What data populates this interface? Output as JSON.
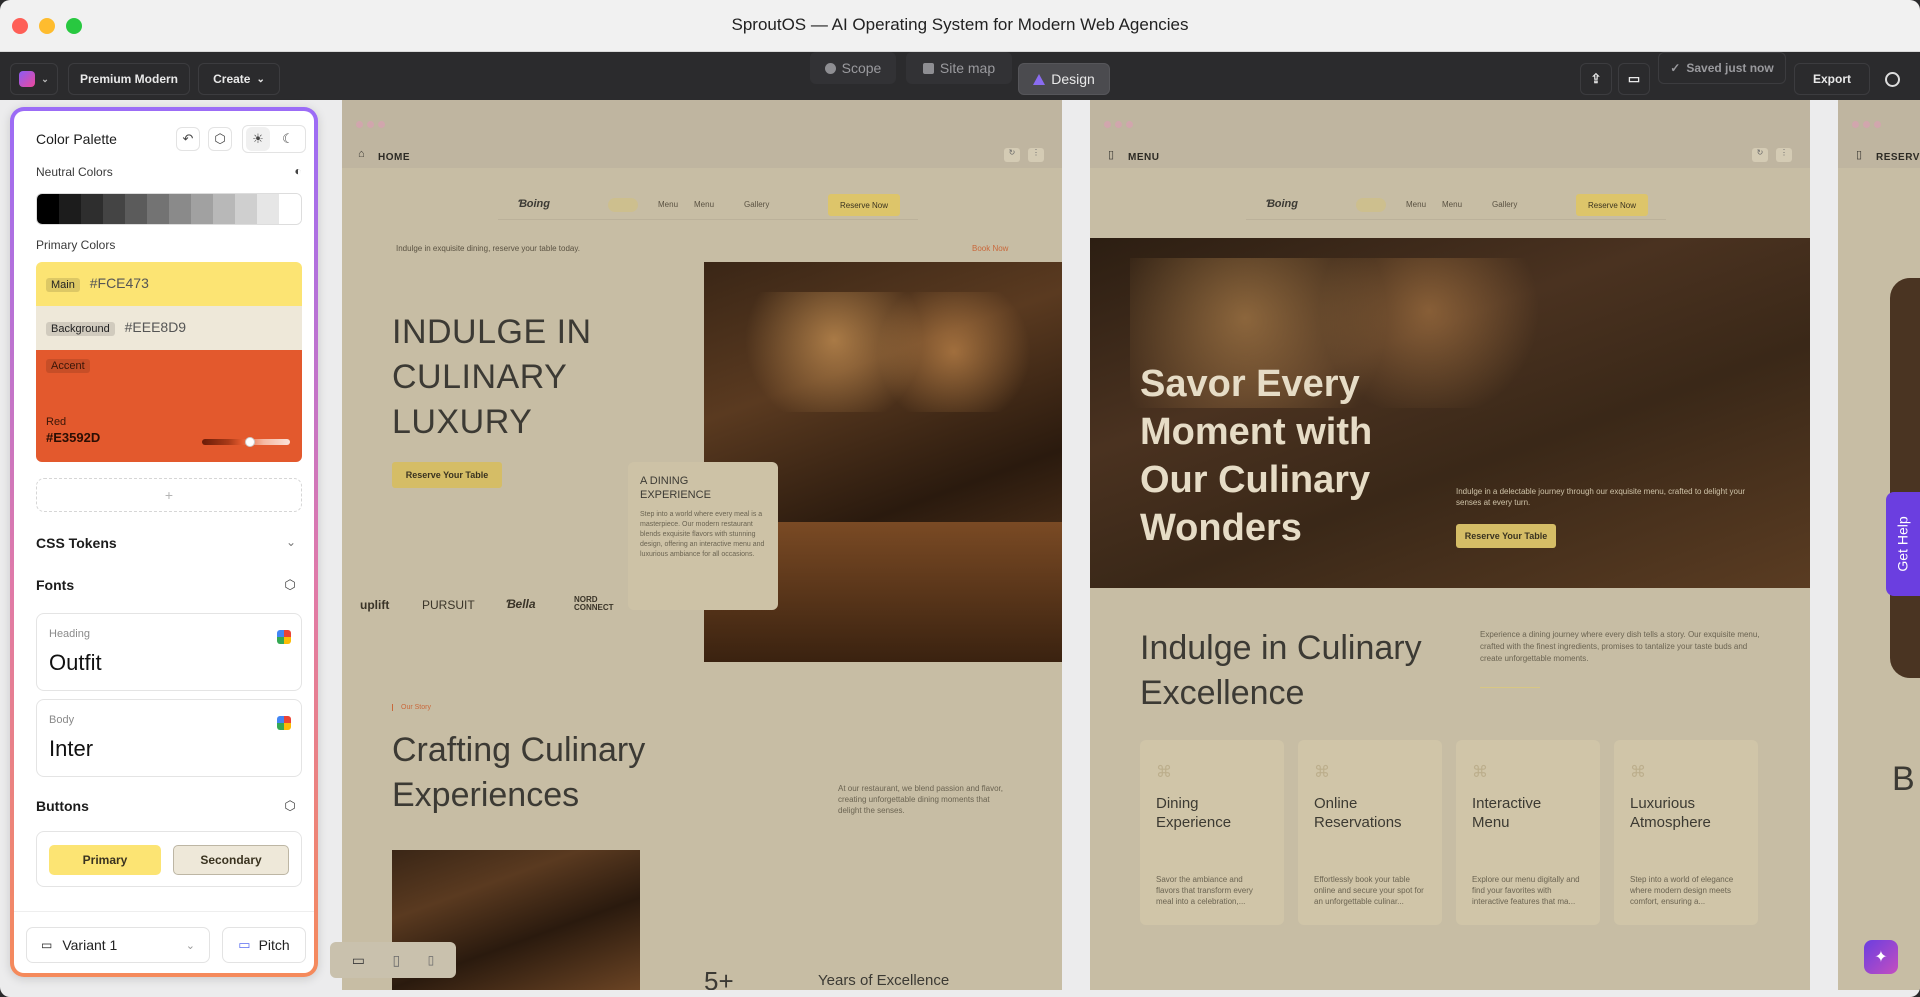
{
  "window": {
    "title": "SproutOS — AI Operating System for Modern Web Agencies"
  },
  "toolbar": {
    "project": "Premium Modern",
    "create": "Create",
    "tabs": [
      {
        "label": "Scope",
        "icon": "circle-icon"
      },
      {
        "label": "Site map",
        "icon": "square-icon"
      },
      {
        "label": "Design",
        "icon": "triangle-icon",
        "active": true
      }
    ],
    "saved": "Saved just now",
    "export": "Export"
  },
  "panel": {
    "color_palette": "Color Palette",
    "neutral_colors": "Neutral Colors",
    "neutral_swatches": [
      "#000000",
      "#1c1c1c",
      "#2e2e2e",
      "#444444",
      "#5b5b5b",
      "#737373",
      "#8a8a8a",
      "#a1a1a1",
      "#b8b8b8",
      "#cfcfcf",
      "#e6e6e6",
      "#ffffff"
    ],
    "primary_colors": "Primary Colors",
    "main": {
      "tag": "Main",
      "value": "#FCE473",
      "color": "#FCE473"
    },
    "background": {
      "tag": "Background",
      "value": "#EEE8D9",
      "color": "#EEE8D9"
    },
    "accent": {
      "tag": "Accent",
      "name": "Red",
      "value": "#E3592D",
      "color": "#E3592D"
    },
    "add": "+",
    "css_tokens": "CSS Tokens",
    "fonts": "Fonts",
    "heading_label": "Heading",
    "heading_font": "Outfit",
    "body_label": "Body",
    "body_font": "Inter",
    "buttons": "Buttons",
    "primary_btn": "Primary",
    "secondary_btn": "Secondary",
    "variant": "Variant 1",
    "pitch": "Pitch"
  },
  "home": {
    "label": "HOME",
    "brand": "Ɓoing",
    "nav": [
      "Menu",
      "Menu",
      "Gallery"
    ],
    "reserve_now": "Reserve Now",
    "tagline": "Indulge in exquisite dining, reserve your table today.",
    "book_now": "Book Now",
    "hero_title": [
      "INDULGE IN",
      "CULINARY",
      "LUXURY"
    ],
    "hero_btn": "Reserve Your Table",
    "dining_title": "A DINING EXPERIENCE",
    "dining_text": "Step into a world where every meal is a masterpiece. Our modern restaurant blends exquisite flavors with stunning design, offering an interactive menu and luxurious ambiance for all occasions.",
    "logos": [
      "uplift",
      "PURSUIT",
      "Ɓella",
      "NORD CONNECT"
    ],
    "story_tag": "Our Story",
    "story_title": [
      "Crafting Culinary",
      "Experiences"
    ],
    "story_text": "At our restaurant, we blend passion and flavor, creating unforgettable dining moments that delight the senses.",
    "stat_num": "5+",
    "stat_label": "Years of Excellence"
  },
  "menu": {
    "label": "MENU",
    "brand": "Ɓoing",
    "nav": [
      "Menu",
      "Menu",
      "Gallery"
    ],
    "reserve_now": "Reserve Now",
    "hero_title": [
      "Savor Every",
      "Moment with",
      "Our Culinary",
      "Wonders"
    ],
    "hero_text": "Indulge in a delectable journey through our exquisite menu, crafted to delight your senses at every turn.",
    "hero_btn": "Reserve Your Table",
    "section_title": [
      "Indulge in Culinary",
      "Excellence"
    ],
    "section_text": "Experience a dining journey where every dish tells a story. Our exquisite menu, crafted with the finest ingredients, promises to tantalize your taste buds and create unforgettable moments.",
    "features": [
      {
        "title": "Dining Experience",
        "text": "Savor the ambiance and flavors that transform every meal into a celebration,..."
      },
      {
        "title": "Online Reservations",
        "text": "Effortlessly book your table online and secure your spot for an unforgettable culinar..."
      },
      {
        "title": "Interactive Menu",
        "text": "Explore our menu digitally and find your favorites with interactive features that ma..."
      },
      {
        "title": "Luxurious Atmosphere",
        "text": "Step into a world of elegance where modern design meets comfort, ensuring a..."
      }
    ]
  },
  "reserve": {
    "label": "RESERV",
    "letter": "B"
  },
  "help": "Get Help"
}
